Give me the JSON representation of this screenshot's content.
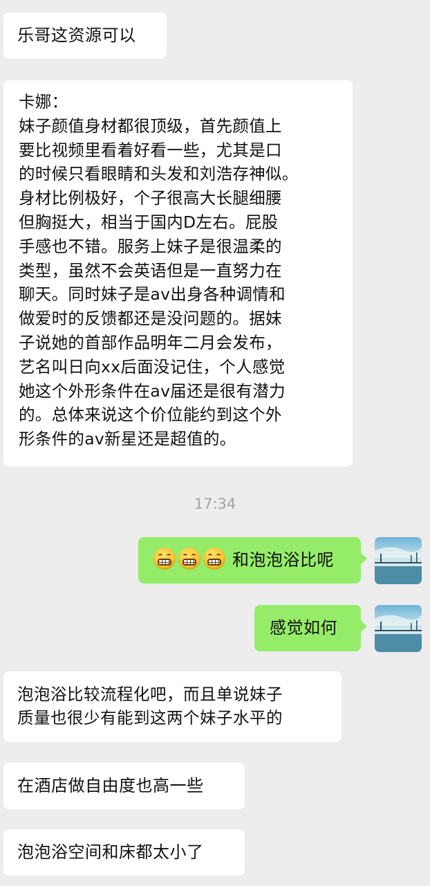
{
  "messages": [
    {
      "side": "left",
      "text": "乐哥这资源可以"
    },
    {
      "side": "left",
      "text": "卡娜：\n妹子颜值身材都很顶级，首先颜值上\n要比视频里看着好看一些，尤其是口\n的时候只看眼睛和头发和刘浩存神似。\n身材比例极好，个子很高大长腿细腰\n但胸挺大，相当于国内D左右。屁股\n手感也不错。服务上妹子是很温柔的\n类型，虽然不会英语但是一直努力在\n聊天。同时妹子是av出身各种调情和\n做爱时的反馈都还是没问题的。据妹\n子说她的首部作品明年二月会发布，\n艺名叫日向xx后面没记住，个人感觉\n她这个外形条件在av届还是很有潜力\n的。总体来说这个价位能约到这个外\n形条件的av新星还是超值的。"
    },
    {
      "side": "time",
      "text": "17:34"
    },
    {
      "side": "right",
      "text": "和泡泡浴比呢",
      "emoji": [
        "grimacing-face-emoji",
        "grimacing-face-emoji",
        "grimacing-face-emoji"
      ]
    },
    {
      "side": "right",
      "text": "感觉如何"
    },
    {
      "side": "left",
      "text": "泡泡浴比较流程化吧，而且单说妹子\n质量也很少有能到这两个妹子水平的"
    },
    {
      "side": "left",
      "text": "在酒店做自由度也高一些"
    },
    {
      "side": "left",
      "text": "泡泡浴空间和床都太小了"
    }
  ],
  "avatar": {
    "icon": "sea-bridge-avatar-icon"
  },
  "colors": {
    "background": "#ededed",
    "left_bubble": "#ffffff",
    "right_bubble": "#95ec69",
    "time": "#a3a3a3"
  }
}
